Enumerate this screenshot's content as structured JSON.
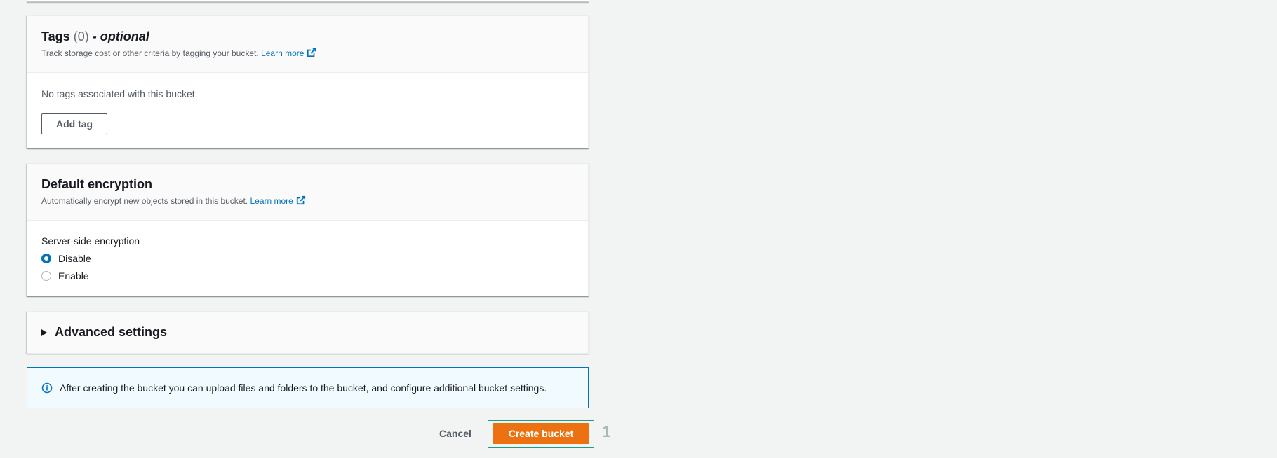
{
  "tags": {
    "title": "Tags",
    "count": "(0)",
    "optional": "- optional",
    "description": "Track storage cost or other criteria by tagging your bucket.",
    "learn_more": "Learn more",
    "empty_text": "No tags associated with this bucket.",
    "add_tag_label": "Add tag"
  },
  "encryption": {
    "title": "Default encryption",
    "description": "Automatically encrypt new objects stored in this bucket.",
    "learn_more": "Learn more",
    "field_label": "Server-side encryption",
    "options": [
      {
        "label": "Disable",
        "selected": true
      },
      {
        "label": "Enable",
        "selected": false
      }
    ]
  },
  "advanced": {
    "title": "Advanced settings"
  },
  "info_alert": {
    "text": "After creating the bucket you can upload files and folders to the bucket, and configure additional bucket settings."
  },
  "footer": {
    "cancel_label": "Cancel",
    "create_label": "Create bucket",
    "step_marker": "1"
  },
  "colors": {
    "primary": "#ec7211",
    "link": "#0073bb",
    "focus": "#16a085"
  }
}
